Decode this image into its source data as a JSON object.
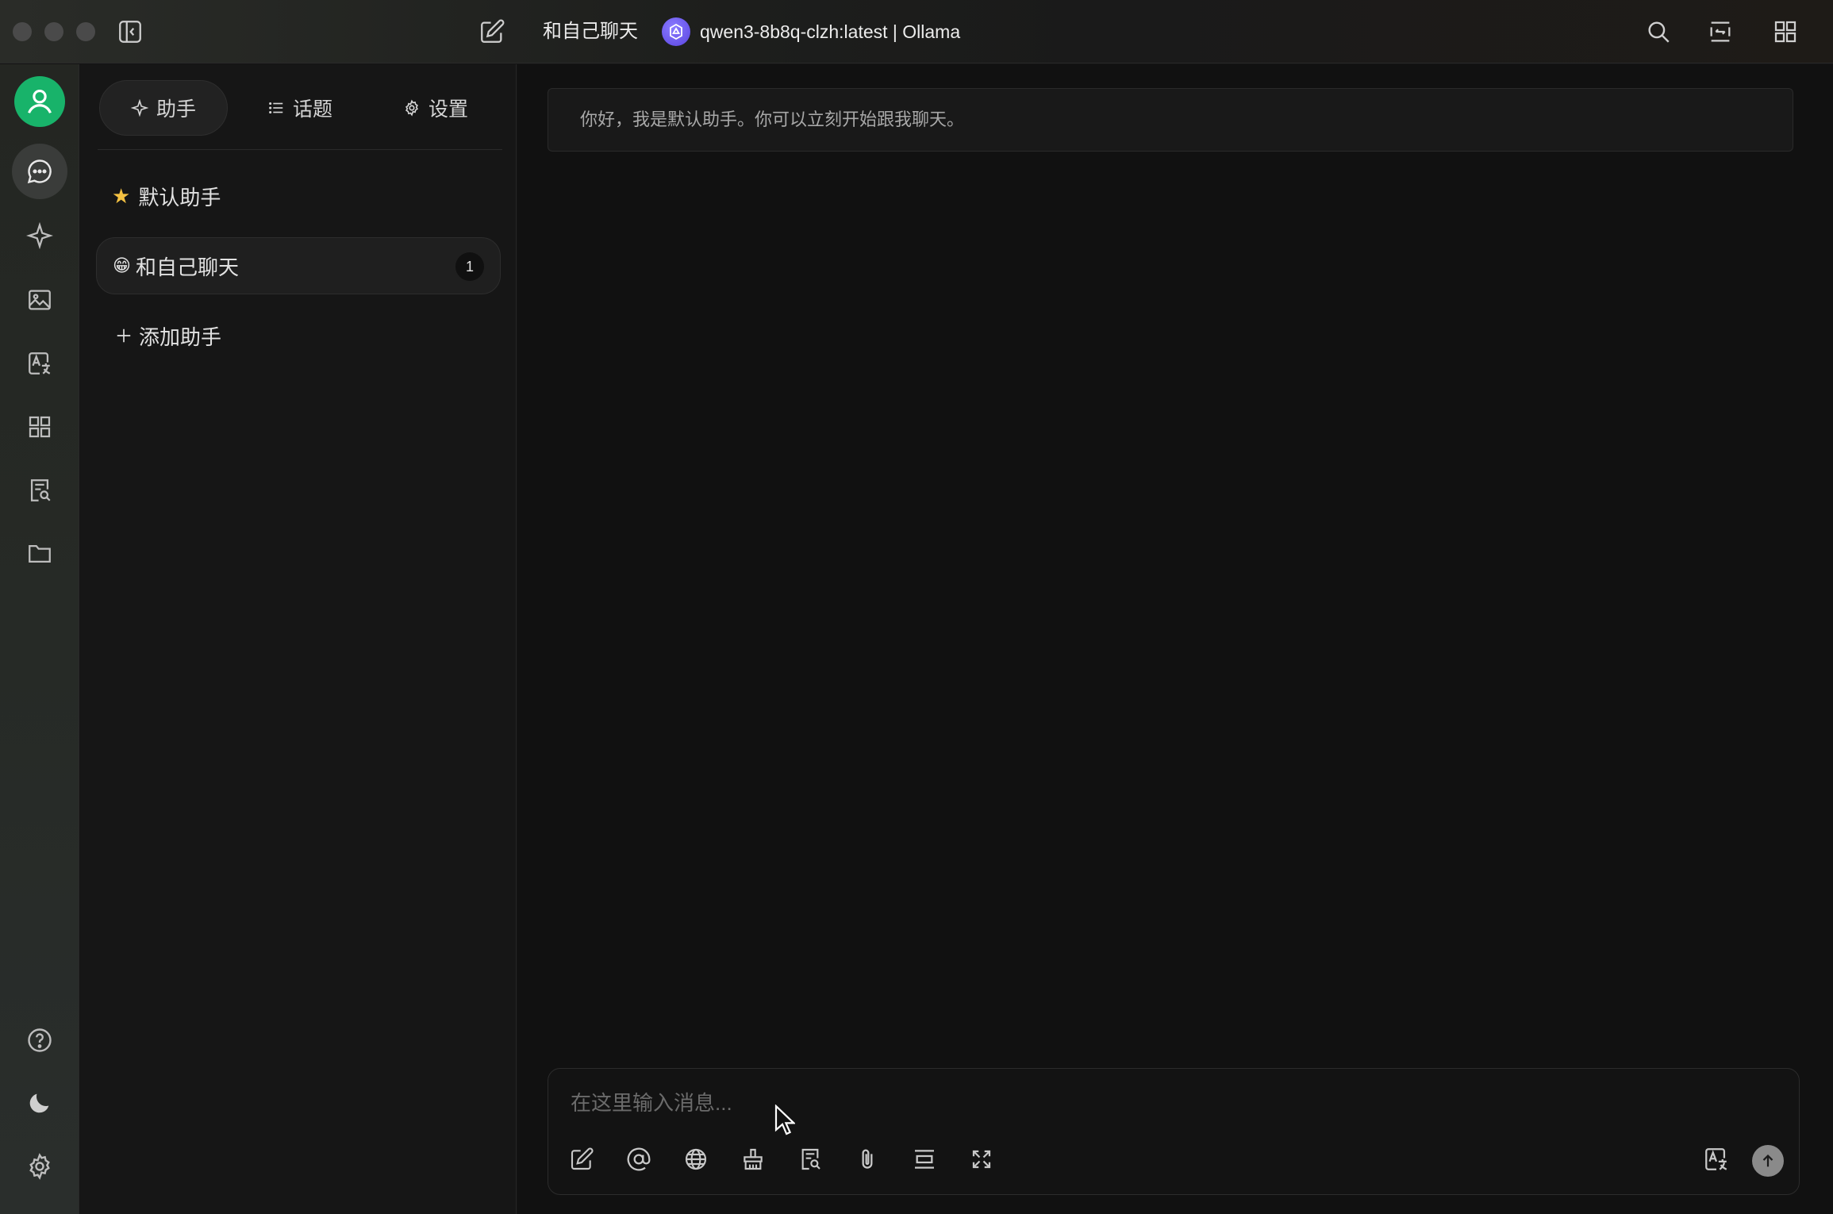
{
  "titlebar": {
    "conversation_title": "和自己聊天",
    "model_label": "qwen3-8b8q-clzh:latest | Ollama",
    "icons": [
      "sidebar-toggle-icon",
      "new-chat-icon",
      "search-icon",
      "swap-layout-icon",
      "grid-icon"
    ]
  },
  "rail": {
    "items": [
      "chat-icon",
      "sparkle-icon",
      "image-icon",
      "translate-icon",
      "apps-icon",
      "file-search-icon",
      "folder-icon"
    ],
    "bottom": [
      "help-icon",
      "moon-icon",
      "settings-icon"
    ]
  },
  "panel": {
    "tabs": {
      "assistant": "助手",
      "topics": "话题",
      "settings": "设置"
    },
    "items": [
      {
        "icon": "★",
        "label": "默认助手"
      },
      {
        "icon": "😁",
        "label": "和自己聊天",
        "count": "1"
      }
    ],
    "add_label": "添加助手"
  },
  "main": {
    "greeting": "你好，我是默认助手。你可以立刻开始跟我聊天。",
    "input_placeholder": "在这里输入消息..."
  },
  "colors": {
    "accent_green": "#18b36a",
    "model_logo": "#6a55f0",
    "star": "#f5c242"
  }
}
